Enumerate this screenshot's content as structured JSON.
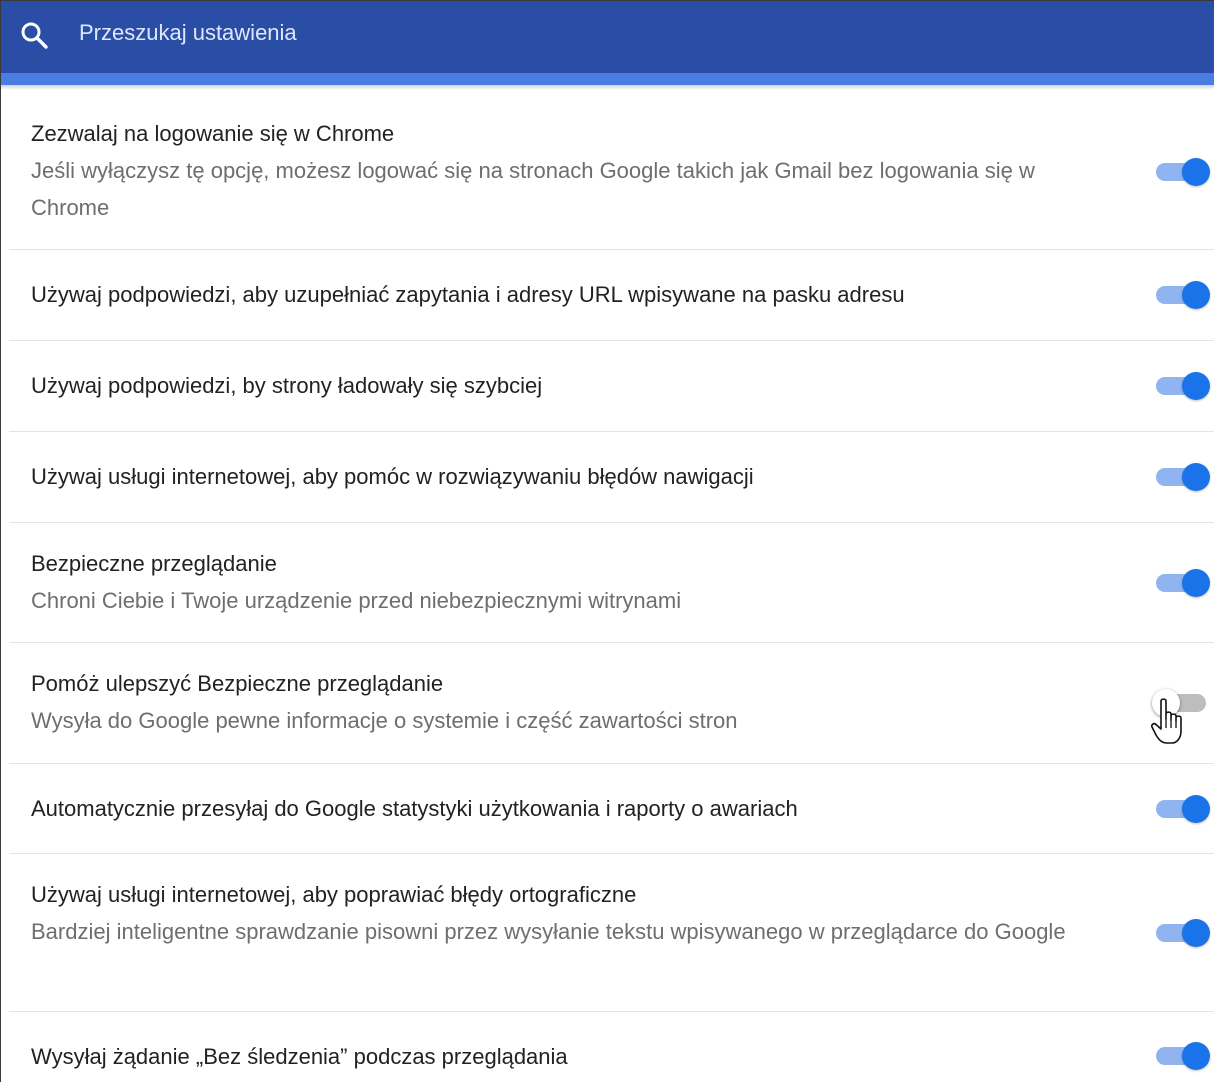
{
  "search": {
    "placeholder": "Przeszukaj ustawienia",
    "icon": "search-icon"
  },
  "colors": {
    "header": "#2a4ea5",
    "accent": "#1a73e8",
    "toggle_track_on": "#8fb4f0",
    "toggle_track_off": "#bdbdbd"
  },
  "settings": [
    {
      "title": "Zezwalaj na logowanie się w Chrome",
      "description": "Jeśli wyłączysz tę opcję, możesz logować się na stronach Google takich jak Gmail bez logowania się w Chrome",
      "enabled": true
    },
    {
      "title": "Używaj podpowiedzi, aby uzupełniać zapytania i adresy URL wpisywane na pasku adresu",
      "description": "",
      "enabled": true
    },
    {
      "title": "Używaj podpowiedzi, by strony ładowały się szybciej",
      "description": "",
      "enabled": true
    },
    {
      "title": "Używaj usługi internetowej, aby pomóc w rozwiązywaniu błędów nawigacji",
      "description": "",
      "enabled": true
    },
    {
      "title": "Bezpieczne przeglądanie",
      "description": "Chroni Ciebie i Twoje urządzenie przed niebezpiecznymi witrynami",
      "enabled": true
    },
    {
      "title": "Pomóż ulepszyć Bezpieczne przeglądanie",
      "description": "Wysyła do Google pewne informacje o systemie i część zawartości stron",
      "enabled": false
    },
    {
      "title": "Automatycznie przesyłaj do Google statystyki użytkowania i raporty o awariach",
      "description": "",
      "enabled": true
    },
    {
      "title": "Używaj usługi internetowej, aby poprawiać błędy ortograficzne",
      "description": "Bardziej inteligentne sprawdzanie pisowni przez wysyłanie tekstu wpisywanego w przeglądarce do Google",
      "enabled": true
    },
    {
      "title": "Wysyłaj żądanie „Bez śledzenia” podczas przeglądania",
      "description": "",
      "enabled": true
    }
  ]
}
